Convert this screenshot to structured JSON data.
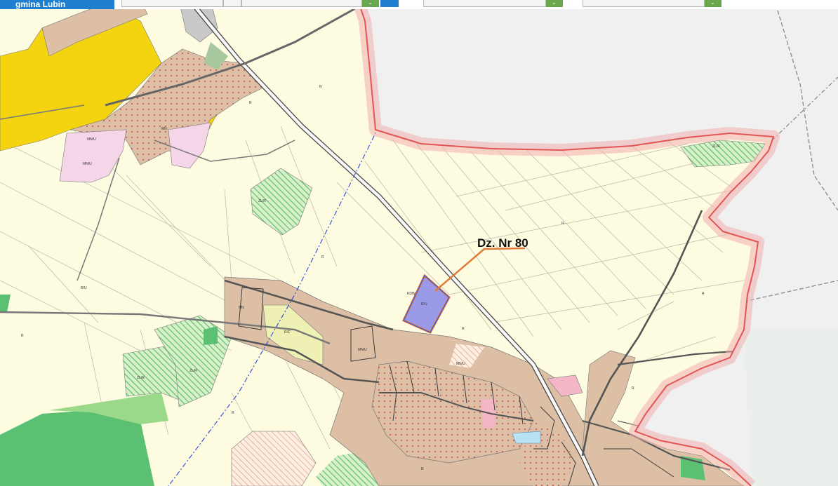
{
  "toolbar": {
    "municipality": "gmina Lubin"
  },
  "map": {
    "parcel_label": "Dz. Nr 80",
    "zone_codes": [
      "MN/U",
      "MN/U",
      "R",
      "R",
      "ZL/R",
      "MN",
      "KDW",
      "R",
      "R/U",
      "R",
      "ZL",
      "R/U",
      "R",
      "R",
      "R",
      "ZL/R",
      "ZL/R"
    ],
    "colors": {
      "boundary": "#e25555",
      "parcel_fill": "#9a9ae8",
      "parcel_stroke": "#e07b39",
      "leader": "#e07b39",
      "agri": "#fdfbe0",
      "residential": "#dcbfa4",
      "yellow_zone": "#f3d40f",
      "forest": "#5cc073",
      "outside": "#f0f0f0"
    }
  }
}
